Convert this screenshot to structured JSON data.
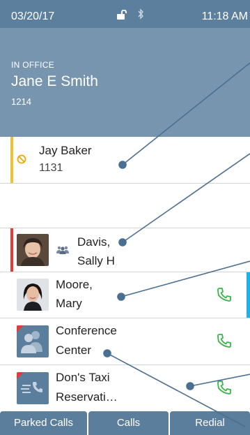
{
  "status_bar": {
    "date": "03/20/17",
    "time": "11:18 AM",
    "lock_icon": "unlock-icon",
    "bluetooth_icon": "bluetooth-icon"
  },
  "header": {
    "presence": "IN OFFICE",
    "name": "Jane E Smith",
    "extension": "1214"
  },
  "lines": [
    {
      "name_line1": "Jay Baker",
      "ext": "1131",
      "status": "do-not-disturb",
      "status_color": "#f2c130"
    },
    {
      "empty": true
    },
    {
      "name_line1": "Davis,",
      "name_line2": "Sally H",
      "status": "busy",
      "status_color": "#e53935",
      "group": true
    },
    {
      "name_line1": "Moore,",
      "name_line2": "Mary",
      "action_icon": "phone-icon"
    },
    {
      "name_line1": "Conference",
      "name_line2": "Center",
      "action_icon": "phone-icon"
    },
    {
      "name_line1": "Don's Taxi",
      "name_line2": "Reservati…",
      "action_icon": "phone-icon"
    }
  ],
  "softkeys": [
    "Parked Calls",
    "Calls",
    "Redial"
  ],
  "colors": {
    "status_bar": "#5d7f9e",
    "header": "#7795af",
    "softkey": "#5b7e9c",
    "busy": "#e53935",
    "dnd": "#f2c130",
    "phone_green": "#3cb34a",
    "scroll_accent": "#1eb2e6",
    "callout": "#4a6f90"
  }
}
